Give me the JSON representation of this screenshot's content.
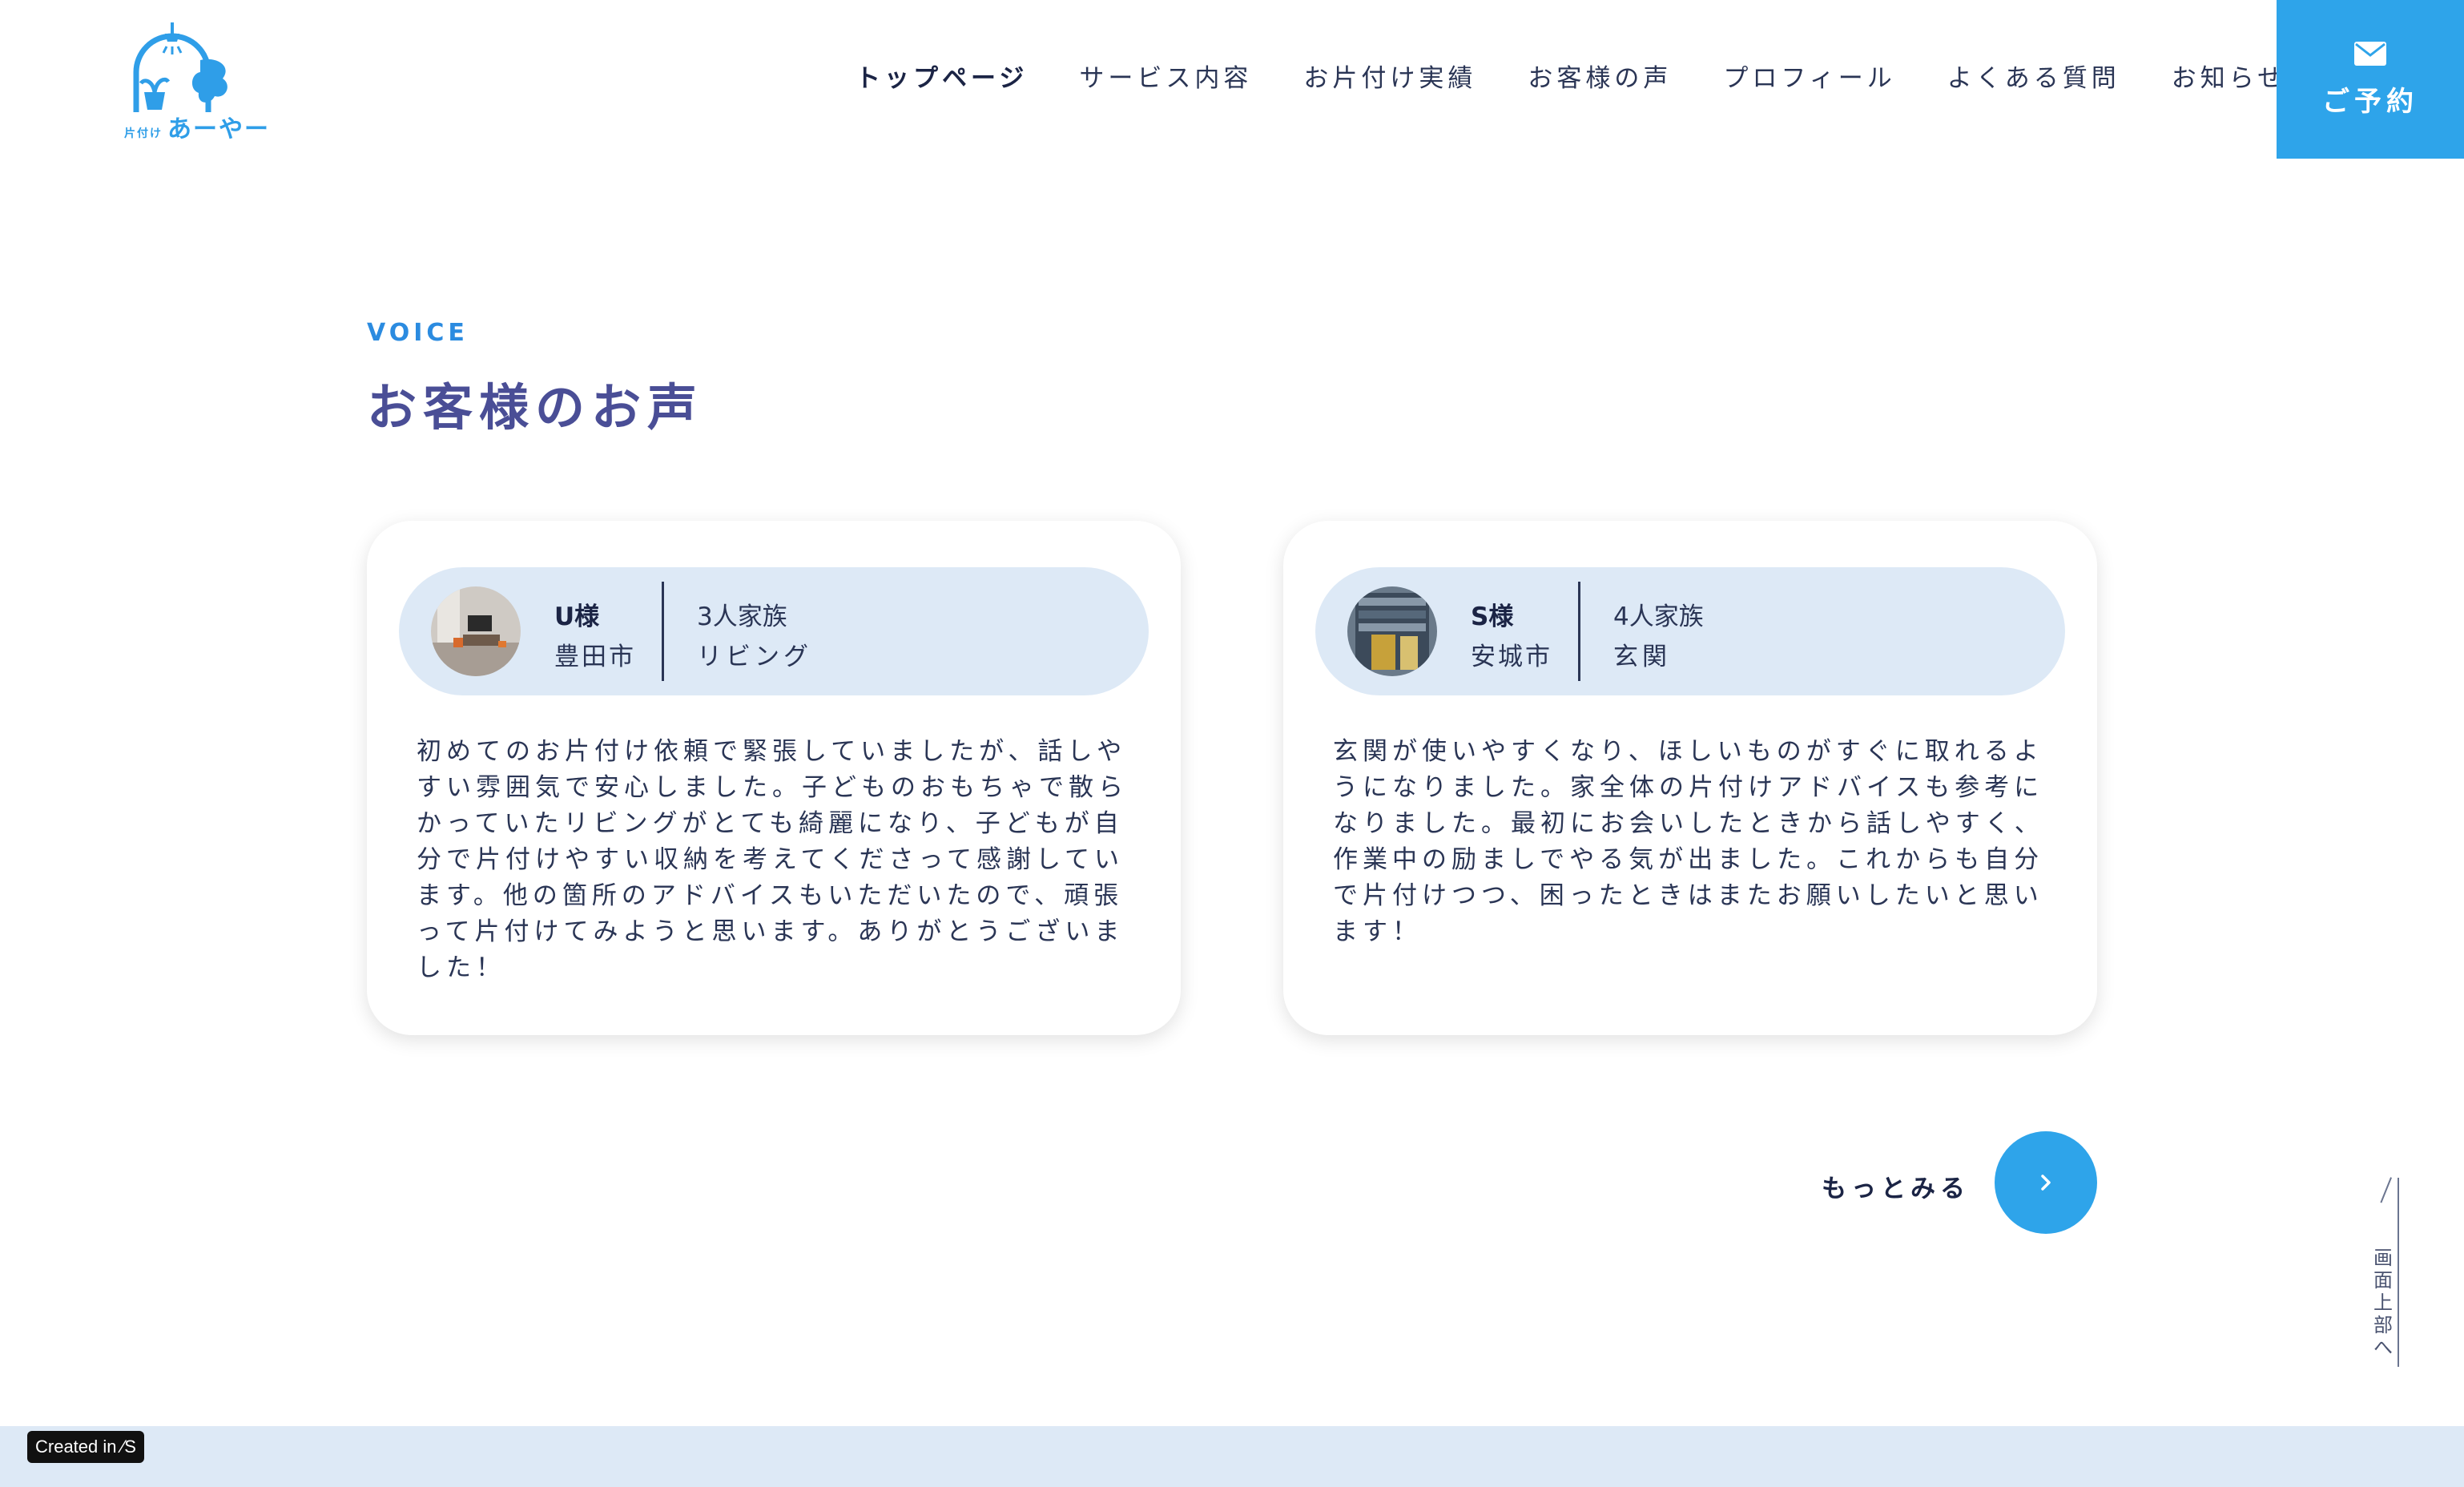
{
  "brand": {
    "small": "片付け",
    "name": "あーやー"
  },
  "nav": [
    {
      "label": "トップページ"
    },
    {
      "label": "サービス内容"
    },
    {
      "label": "お片付け実績"
    },
    {
      "label": "お客様の声"
    },
    {
      "label": "プロフィール"
    },
    {
      "label": "よくある質問"
    },
    {
      "label": "お知らせ"
    }
  ],
  "reserve": {
    "label": "ご予約"
  },
  "section": {
    "en": "VOICE",
    "ja": "お客様のお声"
  },
  "reviews": [
    {
      "name": "U様",
      "city": "豊田市",
      "family": "3人家族",
      "room": "リビング",
      "text": "初めてのお片付け依頼で緊張していましたが、話しやすい雰囲気で安心しました。子どものおもちゃで散らかっていたリビングがとても綺麗になり、子どもが自分で片付けやすい収納を考えてくださって感謝しています。他の箇所のアドバイスもいただいたので、頑張って片付けてみようと思います。ありがとうございました！"
    },
    {
      "name": "S様",
      "city": "安城市",
      "family": "4人家族",
      "room": "玄関",
      "text": "玄関が使いやすくなり、ほしいものがすぐに取れるようになりました。家全体の片付けアドバイスも参考になりました。最初にお会いしたときから話しやすく、作業中の励ましでやる気が出ました。これからも自分で片付けつつ、困ったときはまたお願いしたいと思います！"
    }
  ],
  "more": {
    "label": "もっとみる"
  },
  "totop": {
    "label": "画面上部へ"
  },
  "badge": {
    "label": "Created in ⁄S"
  },
  "colors": {
    "accent": "#2ea4ea",
    "heading": "#4a4e96",
    "pale": "#dde9f6"
  }
}
